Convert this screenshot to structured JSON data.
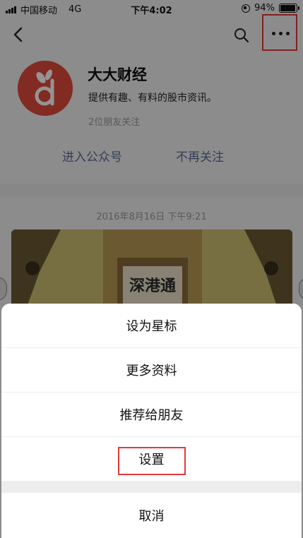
{
  "status_bar": {
    "carrier": "中国移动",
    "network": "4G",
    "time": "下午4:02",
    "battery_percent": "94%",
    "battery_level": 0.94
  },
  "nav": {
    "back_icon": "chevron-left-icon",
    "search_icon": "search-icon",
    "more_icon": "more-dots-icon"
  },
  "account": {
    "name": "大大财经",
    "description": "提供有趣、有料的股市资讯。",
    "friends_following": "2位朋友关注",
    "avatar_letter": "d",
    "avatar_color": "#e04a3b",
    "actions": {
      "enter": "进入公众号",
      "unfollow": "不再关注"
    }
  },
  "feed": {
    "timestamp": "2016年8月16日 下午9:21",
    "article_image_text": "深港通"
  },
  "action_sheet": {
    "items": [
      {
        "label": "设为星标"
      },
      {
        "label": "更多资料"
      },
      {
        "label": "推荐给朋友"
      },
      {
        "label": "设置"
      }
    ],
    "cancel": "取消"
  },
  "colors": {
    "link": "#576b95",
    "highlight": "#e03a3a"
  }
}
